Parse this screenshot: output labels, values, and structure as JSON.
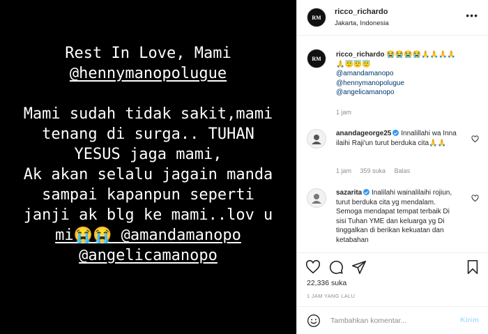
{
  "post_image": {
    "lines": [
      "Rest In Love, Mami",
      "@hennymanopolugue",
      "",
      "Mami sudah tidak sakit,mami",
      "tenang di surga.. TUHAN",
      "YESUS jaga mami,",
      "Ak akan selalu jagain manda",
      "sampai kapanpun seperti",
      "janji ak blg ke mami..lov u",
      "mi😭😭 @amandamanopo",
      "@angelicamanopo"
    ]
  },
  "header": {
    "avatar_text": "RM",
    "username": "ricco_richardo",
    "location": "Jakarta, Indonesia",
    "more_icon": "ellipsis-icon"
  },
  "caption": {
    "username": "ricco_richardo",
    "emojis": "😭😭😭😭🙏🙏🙏🙏🙏😇😇😇",
    "tags": [
      "@amandamanopo",
      "@hennymanopolugue",
      "@angelicamanopo"
    ],
    "time": "1 jam"
  },
  "comments": [
    {
      "username": "anandageorge25",
      "verified": true,
      "text": "Innalillahi wa Inna ilaihi Raji'un turut berduka cita🙏🙏",
      "time": "1 jam",
      "likes": "359 suka",
      "reply": "Balas"
    },
    {
      "username": "sazarita",
      "verified": true,
      "text": "Inalilahi wainalilaihi rojiun, turut berduka cita yg mendalam. Semoga mendapat tempat terbaik Di sisi Tuhan YME dan keluarga yg Di tinggalkan di berikan kekuatan dan ketabahan"
    }
  ],
  "actions": {
    "like_icon": "heart-icon",
    "comment_icon": "comment-icon",
    "share_icon": "share-icon",
    "save_icon": "bookmark-icon"
  },
  "likes_text": "22,336 suka",
  "timestamp": "1 JAM YANG LALU",
  "composer": {
    "placeholder": "Tambahkan komentar...",
    "post_label": "Kirim"
  },
  "colors": {
    "link": "#00376b",
    "verified": "#3897f0",
    "post_disabled": "#b2dffc"
  }
}
